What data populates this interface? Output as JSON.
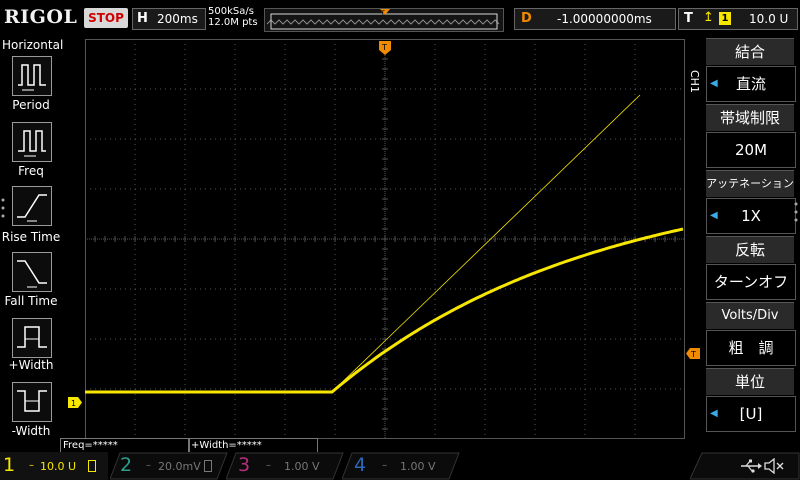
{
  "header": {
    "brand": "RIGOL",
    "run_state": "STOP",
    "horizontal_letter": "H",
    "timebase": "200ms",
    "sample_rate": "500kSa/s",
    "memory_depth": "12.0M pts",
    "delay_letter": "D",
    "delay": "-1.00000000ms",
    "trigger_letter": "T",
    "trigger_source": "1",
    "trigger_level": "10.0 U"
  },
  "left_panel": {
    "title": "Horizontal",
    "items": [
      {
        "label": "Period",
        "icon": "period-icon"
      },
      {
        "label": "Freq",
        "icon": "freq-icon"
      },
      {
        "label": "Rise Time",
        "icon": "rise-time-icon"
      },
      {
        "label": "Fall Time",
        "icon": "fall-time-icon"
      },
      {
        "label": "+Width",
        "icon": "positive-width-icon"
      },
      {
        "label": "-Width",
        "icon": "negative-width-icon"
      }
    ]
  },
  "measurements": {
    "freq": "Freq=*****",
    "width": "+Width=*****"
  },
  "right_panel": {
    "channel_side_label": "CH1",
    "items": [
      {
        "title": "結合",
        "value": "直流",
        "has_arrow": true
      },
      {
        "title": "帯域制限",
        "value": "20M",
        "has_arrow": false
      },
      {
        "title": "アッテネーション",
        "value": "1X",
        "has_arrow": true
      },
      {
        "title": "反転",
        "value": "ターンオフ",
        "has_arrow": false
      },
      {
        "title": "Volts/Div",
        "value": "粗　調",
        "has_arrow": false
      },
      {
        "title": "単位",
        "value": "[U]",
        "has_arrow": true
      }
    ]
  },
  "channels": [
    {
      "num": "1",
      "scale": "10.0 U",
      "color": "#f7e600",
      "active": true
    },
    {
      "num": "2",
      "scale": "20.0mV",
      "color": "#2e9e8e",
      "active": false
    },
    {
      "num": "3",
      "scale": "1.00 V",
      "color": "#b0307a",
      "active": false
    },
    {
      "num": "4",
      "scale": "1.00 V",
      "color": "#2c68b8",
      "active": false
    }
  ],
  "markers": {
    "ch1_ground": "1",
    "trigger_position": "T",
    "trigger_level_marker": "T"
  },
  "colors": {
    "ch1": "#f7e600",
    "trigger": "#f08a00",
    "grid": "#555555",
    "accent": "#3aaae8"
  },
  "status_icons": [
    "usb-icon",
    "speaker-mute-icon"
  ]
}
